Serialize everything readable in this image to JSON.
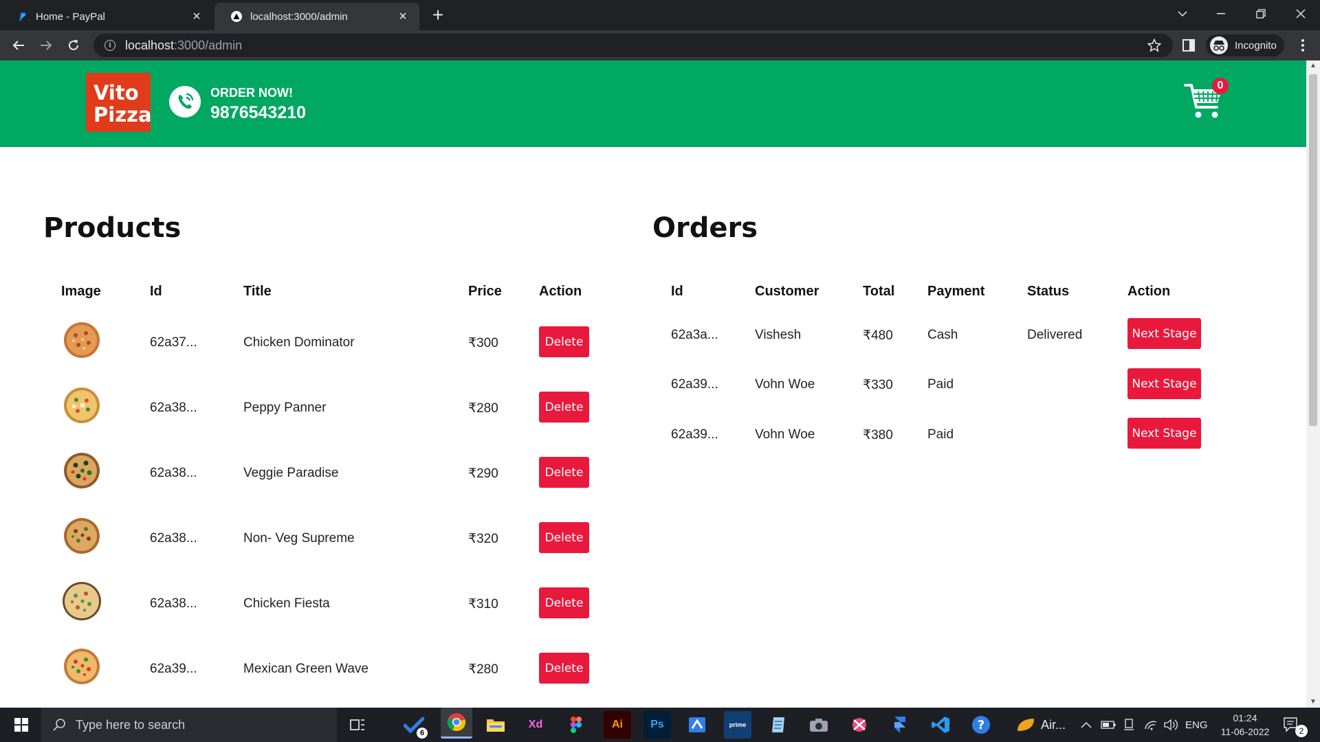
{
  "browser": {
    "tabs": [
      {
        "title": "Home - PayPal",
        "active": false
      },
      {
        "title": "localhost:3000/admin",
        "active": true
      }
    ],
    "address": {
      "host": "localhost",
      "path": ":3000/admin"
    },
    "profile_label": "Incognito"
  },
  "header": {
    "logo_line1": "Vito",
    "logo_line2": "Pizza",
    "order_now": "ORDER NOW!",
    "phone": "9876543210",
    "cart_count": "0",
    "brand_color": "#00a862",
    "accent_color": "#e8193c"
  },
  "products": {
    "title": "Products",
    "columns": [
      "Image",
      "Id",
      "Title",
      "Price",
      "Action"
    ],
    "rows": [
      {
        "id": "62a37...",
        "title": "Chicken Dominator",
        "price": "₹300",
        "action": "Delete"
      },
      {
        "id": "62a38...",
        "title": "Peppy Panner",
        "price": "₹280",
        "action": "Delete"
      },
      {
        "id": "62a38...",
        "title": "Veggie Paradise",
        "price": "₹290",
        "action": "Delete"
      },
      {
        "id": "62a38...",
        "title": "Non- Veg Supreme",
        "price": "₹320",
        "action": "Delete"
      },
      {
        "id": "62a38...",
        "title": "Chicken Fiesta",
        "price": "₹310",
        "action": "Delete"
      },
      {
        "id": "62a39...",
        "title": "Mexican Green Wave",
        "price": "₹280",
        "action": "Delete"
      }
    ]
  },
  "orders": {
    "title": "Orders",
    "columns": [
      "Id",
      "Customer",
      "Total",
      "Payment",
      "Status",
      "Action"
    ],
    "rows": [
      {
        "id": "62a3a...",
        "customer": "Vishesh",
        "total": "₹480",
        "payment": "Cash",
        "status": "Delivered",
        "action": "Next Stage"
      },
      {
        "id": "62a39...",
        "customer": "Vohn Woe",
        "total": "₹330",
        "payment": "Paid",
        "status": "",
        "action": "Next Stage"
      },
      {
        "id": "62a39...",
        "customer": "Vohn Woe",
        "total": "₹380",
        "payment": "Paid",
        "status": "",
        "action": "Next Stage"
      }
    ]
  },
  "taskbar": {
    "search_placeholder": "Type here to search",
    "todo_badge": "6",
    "airplay_label": "Air...",
    "lang": "ENG",
    "time": "01:24",
    "date": "11-06-2022",
    "notif_count": "2"
  }
}
